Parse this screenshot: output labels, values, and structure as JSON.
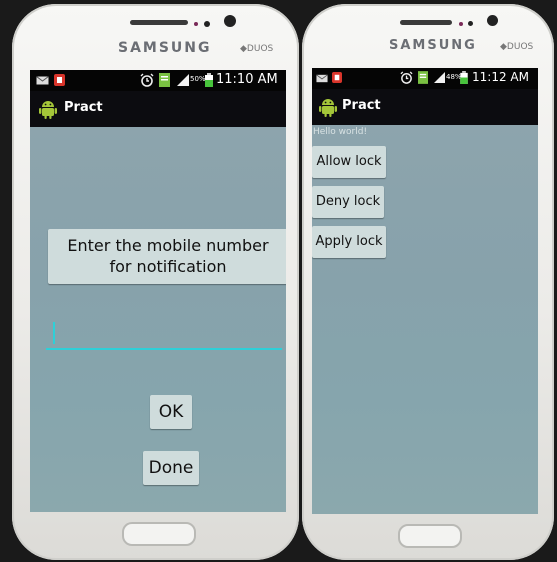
{
  "left_phone": {
    "brand": "SAMSUNG",
    "badge": "DUOS",
    "status": {
      "battery": "50%",
      "time": "11:10 AM"
    },
    "app_title": "Pract",
    "prompt_label": "Enter the mobile number for notification",
    "prompt_line1": "Enter the mobile number",
    "prompt_line2": "for notification",
    "input_value": "",
    "ok_label": "OK",
    "done_label": "Done"
  },
  "right_phone": {
    "brand": "SAMSUNG",
    "badge": "DUOS",
    "status": {
      "battery": "48%",
      "time": "11:12 AM"
    },
    "app_title": "Pract",
    "hello_text": "Hello world!",
    "buttons": [
      "Allow lock",
      "Deny lock",
      "Apply lock"
    ]
  },
  "colors": {
    "screen_bg": "#8da4ad",
    "appbar_bg": "#0c0c10",
    "button_bg": "#cfdcdc",
    "input_underline": "#2ed0d8",
    "android_green": "#a4c639"
  },
  "icons": [
    "email-icon",
    "app-notification-icon",
    "alarm-icon",
    "file-icon",
    "signal-icon",
    "battery-icon",
    "android-icon"
  ]
}
